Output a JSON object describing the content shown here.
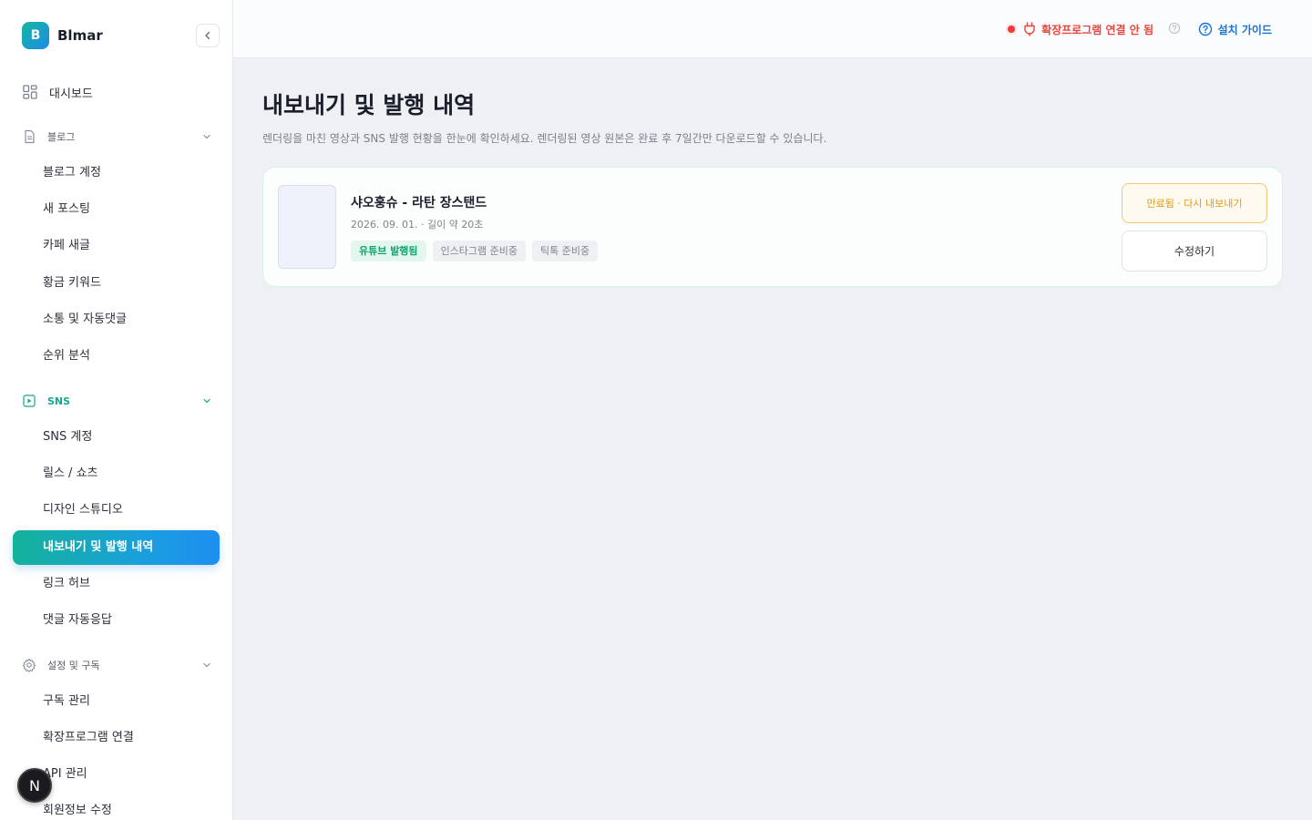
{
  "brand": {
    "logo_letter": "B",
    "name": "Blmar"
  },
  "sidebar": {
    "dashboard": "대시보드",
    "sections": [
      {
        "label": "블로그",
        "items": [
          "블로그 계정",
          "새 포스팅",
          "카페 새글",
          "황금 키워드",
          "소통 및 자동댓글",
          "순위 분석"
        ]
      },
      {
        "label": "SNS",
        "items": [
          "SNS 계정",
          "릴스 / 쇼츠",
          "디자인 스튜디오",
          "내보내기 및 발행 내역",
          "링크 허브",
          "댓글 자동응답"
        ]
      },
      {
        "label": "설정 및 구독",
        "items": [
          "구독 관리",
          "확장프로그램 연결",
          "API 관리",
          "회원정보 수정"
        ]
      }
    ],
    "active_item": "내보내기 및 발행 내역"
  },
  "floating_badge": "N",
  "header": {
    "extension_status": "확장프로그램 연결 안 됨",
    "guide_label": "설치 가이드"
  },
  "main": {
    "title": "내보내기 및 발행 내역",
    "description": "렌더링을 마친 영상과 SNS 발행 현황을 한눈에 확인하세요. 렌더링된 영상 원본은 완료 후 7일간만 다운로드할 수 있습니다.",
    "cards": [
      {
        "title": "샤오훙슈 - 라탄 장스탠드",
        "meta": "2026. 09. 01. · 길이 약 20초",
        "tags": [
          "유튜브 발행됨",
          "인스타그램 준비중",
          "틱톡 준비중"
        ],
        "expired_button": "만료됨 · 다시 내보내기",
        "edit_button": "수정하기"
      }
    ]
  },
  "colors": {
    "accent_teal": "#14b39a",
    "accent_blue": "#1e8ef0",
    "error_red": "#e8453c",
    "link_blue": "#1a73d9",
    "warning_orange": "#e09a1a"
  },
  "icons": {
    "dashboard": "grid-icon",
    "blog": "document-icon",
    "sns": "play-icon",
    "settings": "gear-icon",
    "extension": "plug-icon",
    "help": "question-circle-icon"
  }
}
